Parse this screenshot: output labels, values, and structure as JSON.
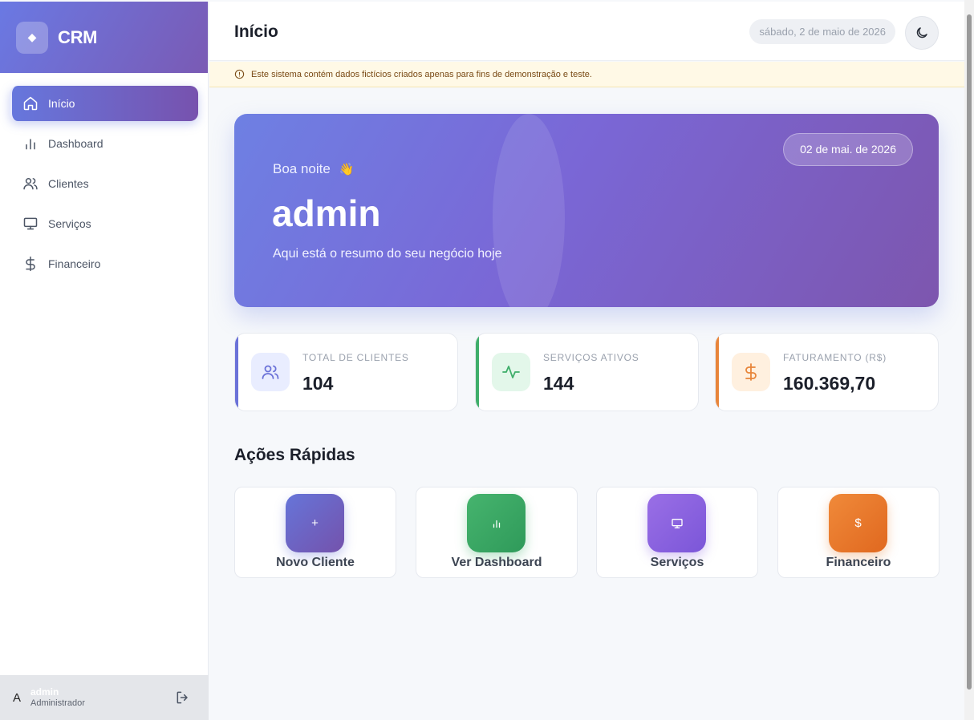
{
  "brand": {
    "name": "CRM"
  },
  "sidebar": {
    "items": [
      {
        "label": "Início",
        "icon": "home-icon",
        "active": true
      },
      {
        "label": "Dashboard",
        "icon": "bar-chart-icon"
      },
      {
        "label": "Clientes",
        "icon": "users-icon"
      },
      {
        "label": "Serviços",
        "icon": "monitor-icon"
      },
      {
        "label": "Financeiro",
        "icon": "dollar-icon"
      }
    ],
    "user": {
      "avatar_initial": "A",
      "name": "admin",
      "role": "Administrador"
    }
  },
  "header": {
    "title": "Início",
    "date": "sábado, 2 de maio de 2026",
    "theme_icon": "moon-icon"
  },
  "notice": {
    "text": "Este sistema contém dados fictícios criados apenas para fins de demonstração e teste."
  },
  "hero": {
    "greeting": "Boa noite",
    "wave": "👋",
    "name": "admin",
    "subtitle": "Aqui está o resumo do seu negócio hoje",
    "date": "02 de mai. de 2026"
  },
  "stats": [
    {
      "label": "TOTAL DE CLIENTES",
      "value": "104",
      "color": "#6b72d8",
      "icon": "users-icon"
    },
    {
      "label": "SERVIÇOS ATIVOS",
      "value": "144",
      "color": "#3fae6a",
      "icon": "activity-icon"
    },
    {
      "label": "FATURAMENTO (R$)",
      "value": "160.369,70",
      "color": "#e8853a",
      "icon": "dollar-icon"
    }
  ],
  "quick_actions": {
    "title": "Ações Rápidas",
    "items": [
      {
        "label": "Novo Cliente",
        "glyph": "+",
        "icon": "plus-icon"
      },
      {
        "label": "Ver Dashboard",
        "glyph": "",
        "icon": "bar-chart-icon"
      },
      {
        "label": "Serviços",
        "glyph": "",
        "icon": "monitor-icon"
      },
      {
        "label": "Financeiro",
        "glyph": "$",
        "icon": "dollar-icon"
      }
    ]
  }
}
